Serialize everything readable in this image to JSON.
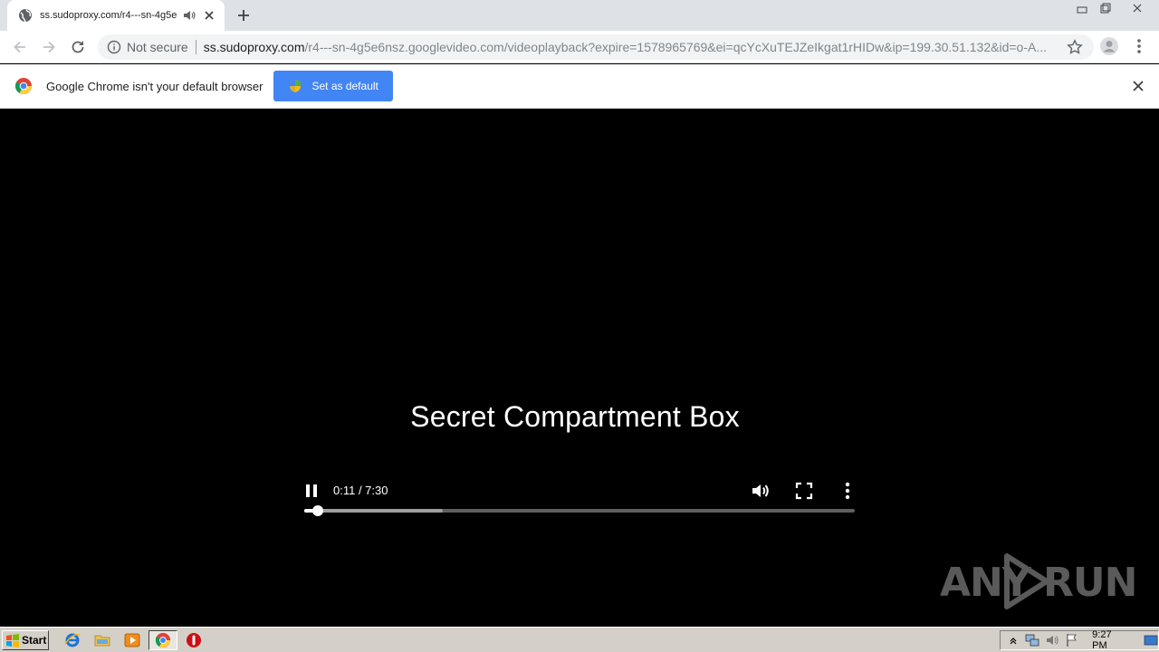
{
  "browser": {
    "tab": {
      "title": "ss.sudoproxy.com/r4---sn-4g5e"
    },
    "omnibox": {
      "security_label": "Not secure",
      "host": "ss.sudoproxy.com",
      "path": "/r4---sn-4g5e6nsz.googlevideo.com/videoplayback?expire=1578965769&ei=qcYcXuTEJZeIkgat1rHIDw&ip=199.30.51.132&id=o-A..."
    },
    "infobar": {
      "message": "Google Chrome isn't your default browser",
      "button_label": "Set as default"
    }
  },
  "video": {
    "title": "Secret Compartment Box",
    "time_display": "0:11 / 7:30",
    "current_seconds": 11,
    "duration_seconds": 450,
    "buffered_seconds": 113
  },
  "watermark": {
    "left": "ANY",
    "right": "RUN"
  },
  "taskbar": {
    "start_label": "Start",
    "clock": "9:27 PM"
  },
  "colors": {
    "accent": "#4285f4",
    "taskbar": "#d4d0c8",
    "video_bg": "#000000"
  }
}
